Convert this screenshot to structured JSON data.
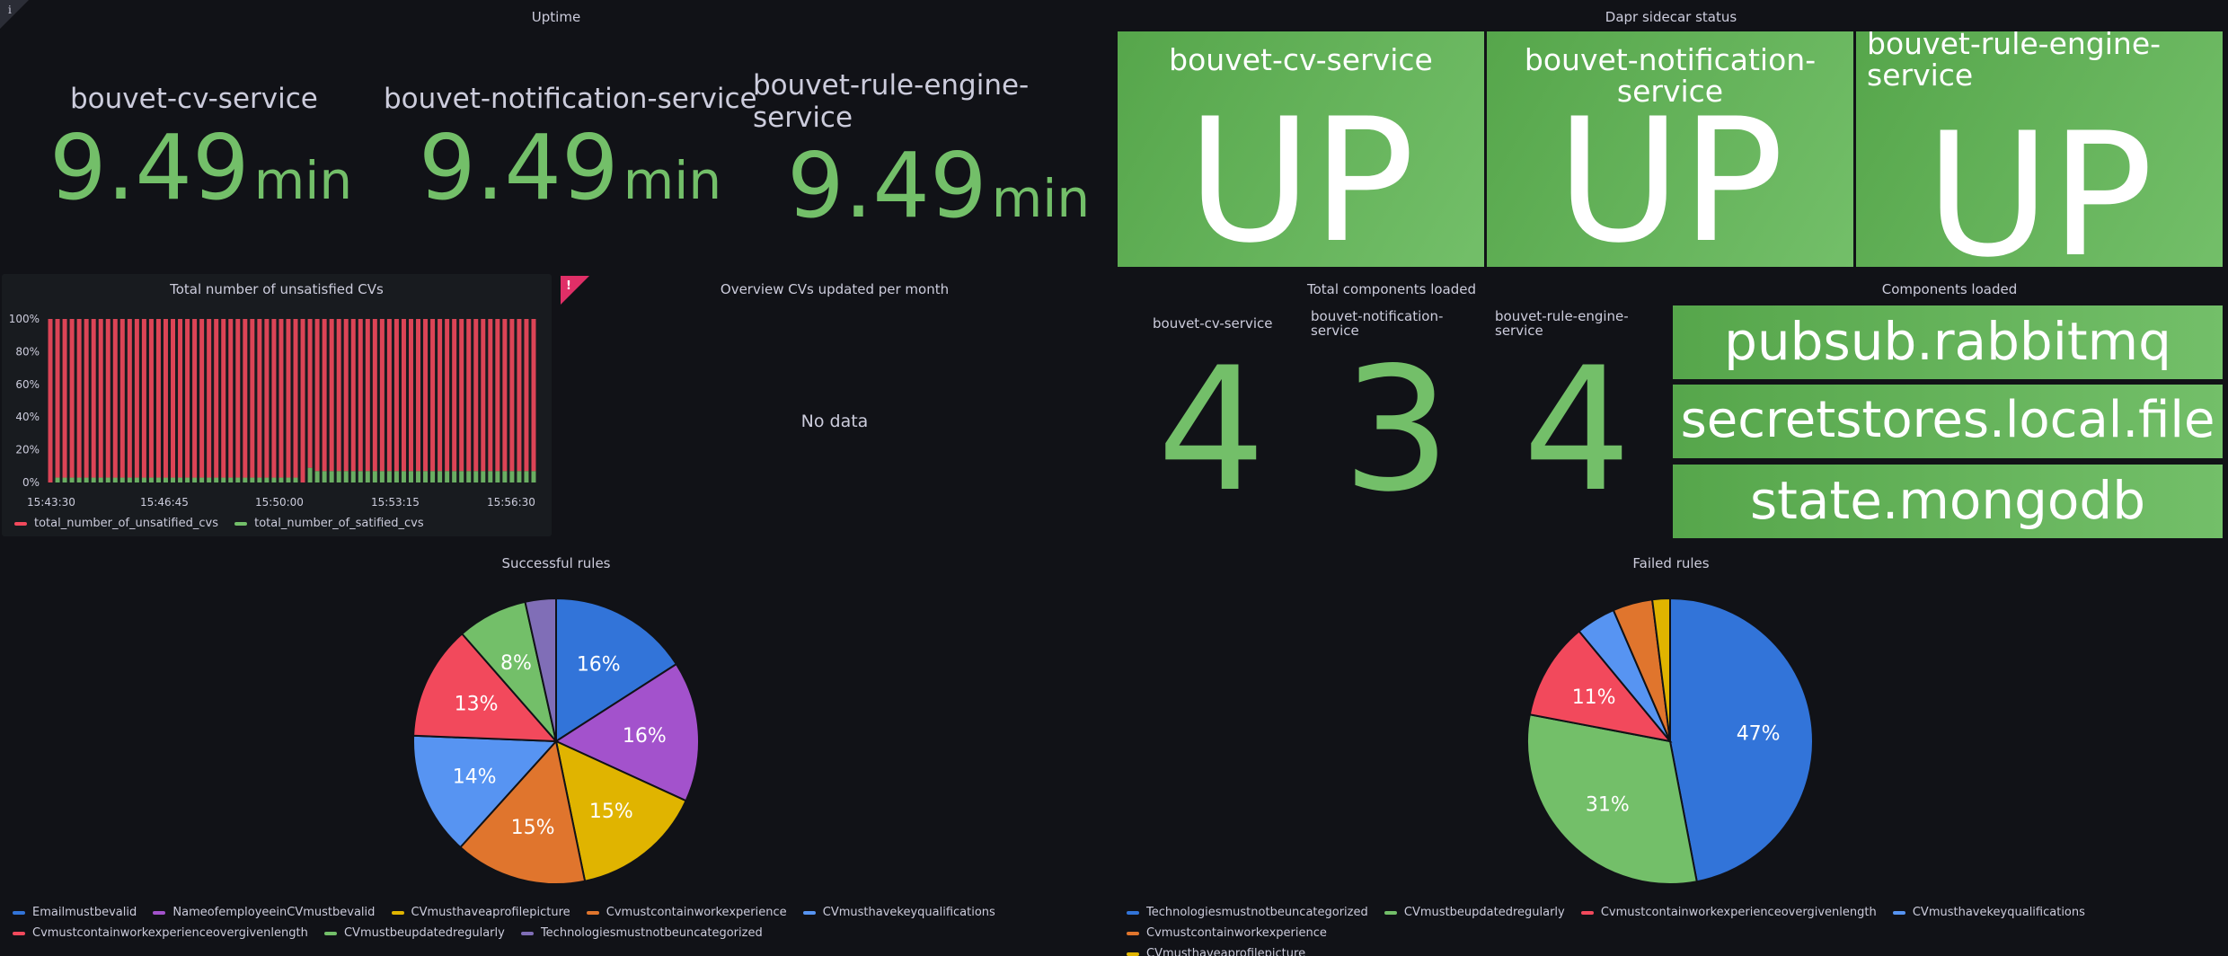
{
  "uptime": {
    "title": "Uptime",
    "items": [
      {
        "name": "bouvet-cv-service",
        "value": "9.49",
        "unit": "min"
      },
      {
        "name": "bouvet-notification-service",
        "value": "9.49",
        "unit": "min"
      },
      {
        "name": "bouvet-rule-engine-service",
        "value": "9.49",
        "unit": "min"
      }
    ]
  },
  "dapr": {
    "title": "Dapr sidecar status",
    "items": [
      {
        "name": "bouvet-cv-service",
        "status": "UP"
      },
      {
        "name": "bouvet-notification-service",
        "status": "UP"
      },
      {
        "name": "bouvet-rule-engine-service",
        "status": "UP"
      }
    ]
  },
  "unsatisfied": {
    "title": "Total number of unsatisfied CVs",
    "legend": [
      {
        "label": "total_number_of_unsatified_cvs",
        "color": "#f2495c"
      },
      {
        "label": "total_number_of_satified_cvs",
        "color": "#73bf69"
      }
    ]
  },
  "overview": {
    "title": "Overview CVs updated per month",
    "empty_text": "No data",
    "alert_icon": "alert-icon"
  },
  "components_total": {
    "title": "Total components loaded",
    "items": [
      {
        "name": "bouvet-cv-service",
        "value": "4"
      },
      {
        "name": "bouvet-notification-service",
        "value": "3"
      },
      {
        "name": "bouvet-rule-engine-service",
        "value": "4"
      }
    ]
  },
  "components_loaded": {
    "title": "Components loaded",
    "items": [
      "pubsub.rabbitmq",
      "secretstores.local.file",
      "state.mongodb"
    ]
  },
  "successful_rules": {
    "title": "Successful rules",
    "legend": [
      {
        "label": "Emailmustbevalid",
        "color": "#3274d9"
      },
      {
        "label": "NameofemployeeinCVmustbevalid",
        "color": "#a352cc"
      },
      {
        "label": "CVmusthaveaprofilepicture",
        "color": "#e0b400"
      },
      {
        "label": "Cvmustcontainworkexperience",
        "color": "#e0752d"
      },
      {
        "label": "CVmusthavekeyqualifications",
        "color": "#5794f2"
      },
      {
        "label": "Cvmustcontainworkexperienceovergivenlength",
        "color": "#f2495c"
      },
      {
        "label": "CVmustbeupdatedregularly",
        "color": "#73bf69"
      },
      {
        "label": "Technologiesmustnotbeuncategorized",
        "color": "#806eb7"
      }
    ]
  },
  "failed_rules": {
    "title": "Failed rules",
    "legend": [
      {
        "label": "Technologiesmustnotbeuncategorized",
        "color": "#3274d9"
      },
      {
        "label": "CVmustbeupdatedregularly",
        "color": "#73bf69"
      },
      {
        "label": "Cvmustcontainworkexperienceovergivenlength",
        "color": "#f2495c"
      },
      {
        "label": "CVmusthavekeyqualifications",
        "color": "#5794f2"
      },
      {
        "label": "Cvmustcontainworkexperience",
        "color": "#e0752d"
      },
      {
        "label": "CVmusthaveaprofilepicture",
        "color": "#e0b400"
      }
    ]
  },
  "chart_data": [
    {
      "type": "bar",
      "title": "Total number of unsatisfied CVs",
      "x_ticks": [
        "15:43:30",
        "15:46:45",
        "15:50:00",
        "15:53:15",
        "15:56:30"
      ],
      "y_ticks": [
        "0%",
        "20%",
        "40%",
        "60%",
        "80%",
        "100%"
      ],
      "ylim": [
        0,
        100
      ],
      "stacked": true,
      "bar_count": 68,
      "series": [
        {
          "name": "total_number_of_unsatified_cvs",
          "color": "#f2495c",
          "values": [
            100,
            97,
            97,
            97,
            97,
            97,
            97,
            97,
            97,
            97,
            97,
            97,
            97,
            97,
            97,
            97,
            97,
            97,
            97,
            97,
            97,
            97,
            97,
            97,
            97,
            97,
            97,
            97,
            97,
            97,
            97,
            97,
            97,
            97,
            97,
            100,
            91,
            93,
            93,
            93,
            93,
            93,
            93,
            93,
            93,
            93,
            93,
            93,
            93,
            93,
            93,
            93,
            93,
            93,
            93,
            93,
            93,
            93,
            93,
            93,
            93,
            93,
            93,
            93,
            93,
            93,
            93,
            93
          ]
        },
        {
          "name": "total_number_of_satified_cvs",
          "color": "#73bf69",
          "values": [
            0,
            3,
            3,
            3,
            3,
            3,
            3,
            3,
            3,
            3,
            3,
            3,
            3,
            3,
            3,
            3,
            3,
            3,
            3,
            3,
            3,
            3,
            3,
            3,
            3,
            3,
            3,
            3,
            3,
            3,
            3,
            3,
            3,
            3,
            3,
            0,
            9,
            7,
            7,
            7,
            7,
            7,
            7,
            7,
            7,
            7,
            7,
            7,
            7,
            7,
            7,
            7,
            7,
            7,
            7,
            7,
            7,
            7,
            7,
            7,
            7,
            7,
            7,
            7,
            7,
            7,
            7,
            7
          ]
        }
      ]
    },
    {
      "type": "pie",
      "title": "Successful rules",
      "series": [
        {
          "name": "Emailmustbevalid",
          "value": 16,
          "label": "16%",
          "color": "#3274d9"
        },
        {
          "name": "NameofemployeeinCVmustbevalid",
          "value": 16,
          "label": "16%",
          "color": "#a352cc"
        },
        {
          "name": "CVmusthaveaprofilepicture",
          "value": 15,
          "label": "15%",
          "color": "#e0b400"
        },
        {
          "name": "Cvmustcontainworkexperience",
          "value": 15,
          "label": "15%",
          "color": "#e0752d"
        },
        {
          "name": "CVmusthavekeyqualifications",
          "value": 14,
          "label": "14%",
          "color": "#5794f2"
        },
        {
          "name": "Cvmustcontainworkexperienceovergivenlength",
          "value": 13,
          "label": "13%",
          "color": "#f2495c"
        },
        {
          "name": "CVmustbeupdatedregularly",
          "value": 8,
          "label": "8%",
          "color": "#73bf69"
        },
        {
          "name": "Technologiesmustnotbeuncategorized",
          "value": 3.5,
          "label": "",
          "color": "#806eb7"
        }
      ]
    },
    {
      "type": "pie",
      "title": "Failed rules",
      "series": [
        {
          "name": "Technologiesmustnotbeuncategorized",
          "value": 47,
          "label": "47%",
          "color": "#3274d9"
        },
        {
          "name": "CVmustbeupdatedregularly",
          "value": 31,
          "label": "31%",
          "color": "#73bf69"
        },
        {
          "name": "Cvmustcontainworkexperienceovergivenlength",
          "value": 11,
          "label": "11%",
          "color": "#f2495c"
        },
        {
          "name": "CVmusthavekeyqualifications",
          "value": 4.5,
          "label": "",
          "color": "#5794f2"
        },
        {
          "name": "Cvmustcontainworkexperience",
          "value": 4.5,
          "label": "",
          "color": "#e0752d"
        },
        {
          "name": "CVmusthaveaprofilepicture",
          "value": 2,
          "label": "",
          "color": "#e0b400"
        }
      ]
    }
  ]
}
